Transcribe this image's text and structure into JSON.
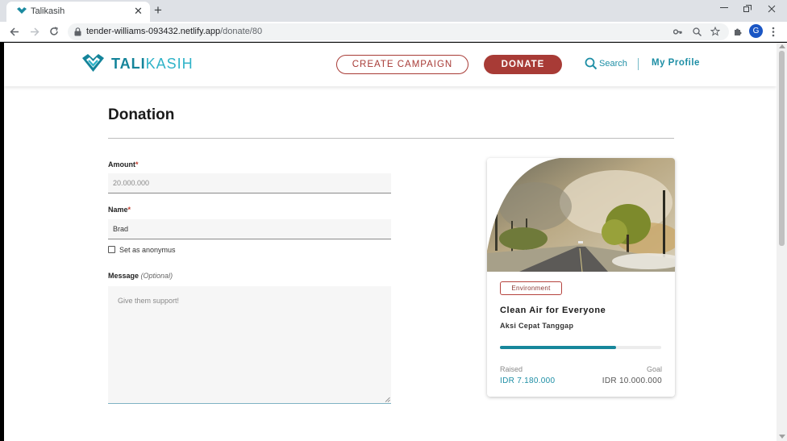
{
  "browser": {
    "tab_title": "Talikasih",
    "tab_close": "✕",
    "new_tab": "+",
    "url_host": "tender-williams-093432.netlify.app",
    "url_path": "/donate/80",
    "profile_initial": "G",
    "icons": [
      "back-icon",
      "forward-icon",
      "reload-icon",
      "lock-icon",
      "key-icon",
      "zoom-icon",
      "star-icon",
      "extensions-icon",
      "menu-icon"
    ]
  },
  "header": {
    "logo_part1": "TALI",
    "logo_part2": "KASIH",
    "create_campaign": "CREATE CAMPAIGN",
    "donate": "DONATE",
    "search": "Search",
    "my_profile": "My Profile"
  },
  "page": {
    "title": "Donation"
  },
  "form": {
    "amount_label": "Amount",
    "amount_value": "20.000.000",
    "name_label": "Name",
    "name_value": "Brad",
    "required_mark": "*",
    "anonymous_label": "Set as anonymus",
    "anonymous_checked": false,
    "message_label": "Message",
    "message_optional": "(Optional)",
    "message_placeholder": "Give them support!"
  },
  "campaign": {
    "category": "Environment",
    "title": "Clean Air for Everyone",
    "organizer": "Aksi Cepat Tanggap",
    "progress": 0.718,
    "raised_label": "Raised",
    "raised_value": "IDR 7.180.000",
    "goal_label": "Goal",
    "goal_value": "IDR 10.000.000"
  },
  "colors": {
    "brand_teal": "#14849a",
    "brand_red": "#a83b36",
    "link": "#1d8ea5"
  }
}
